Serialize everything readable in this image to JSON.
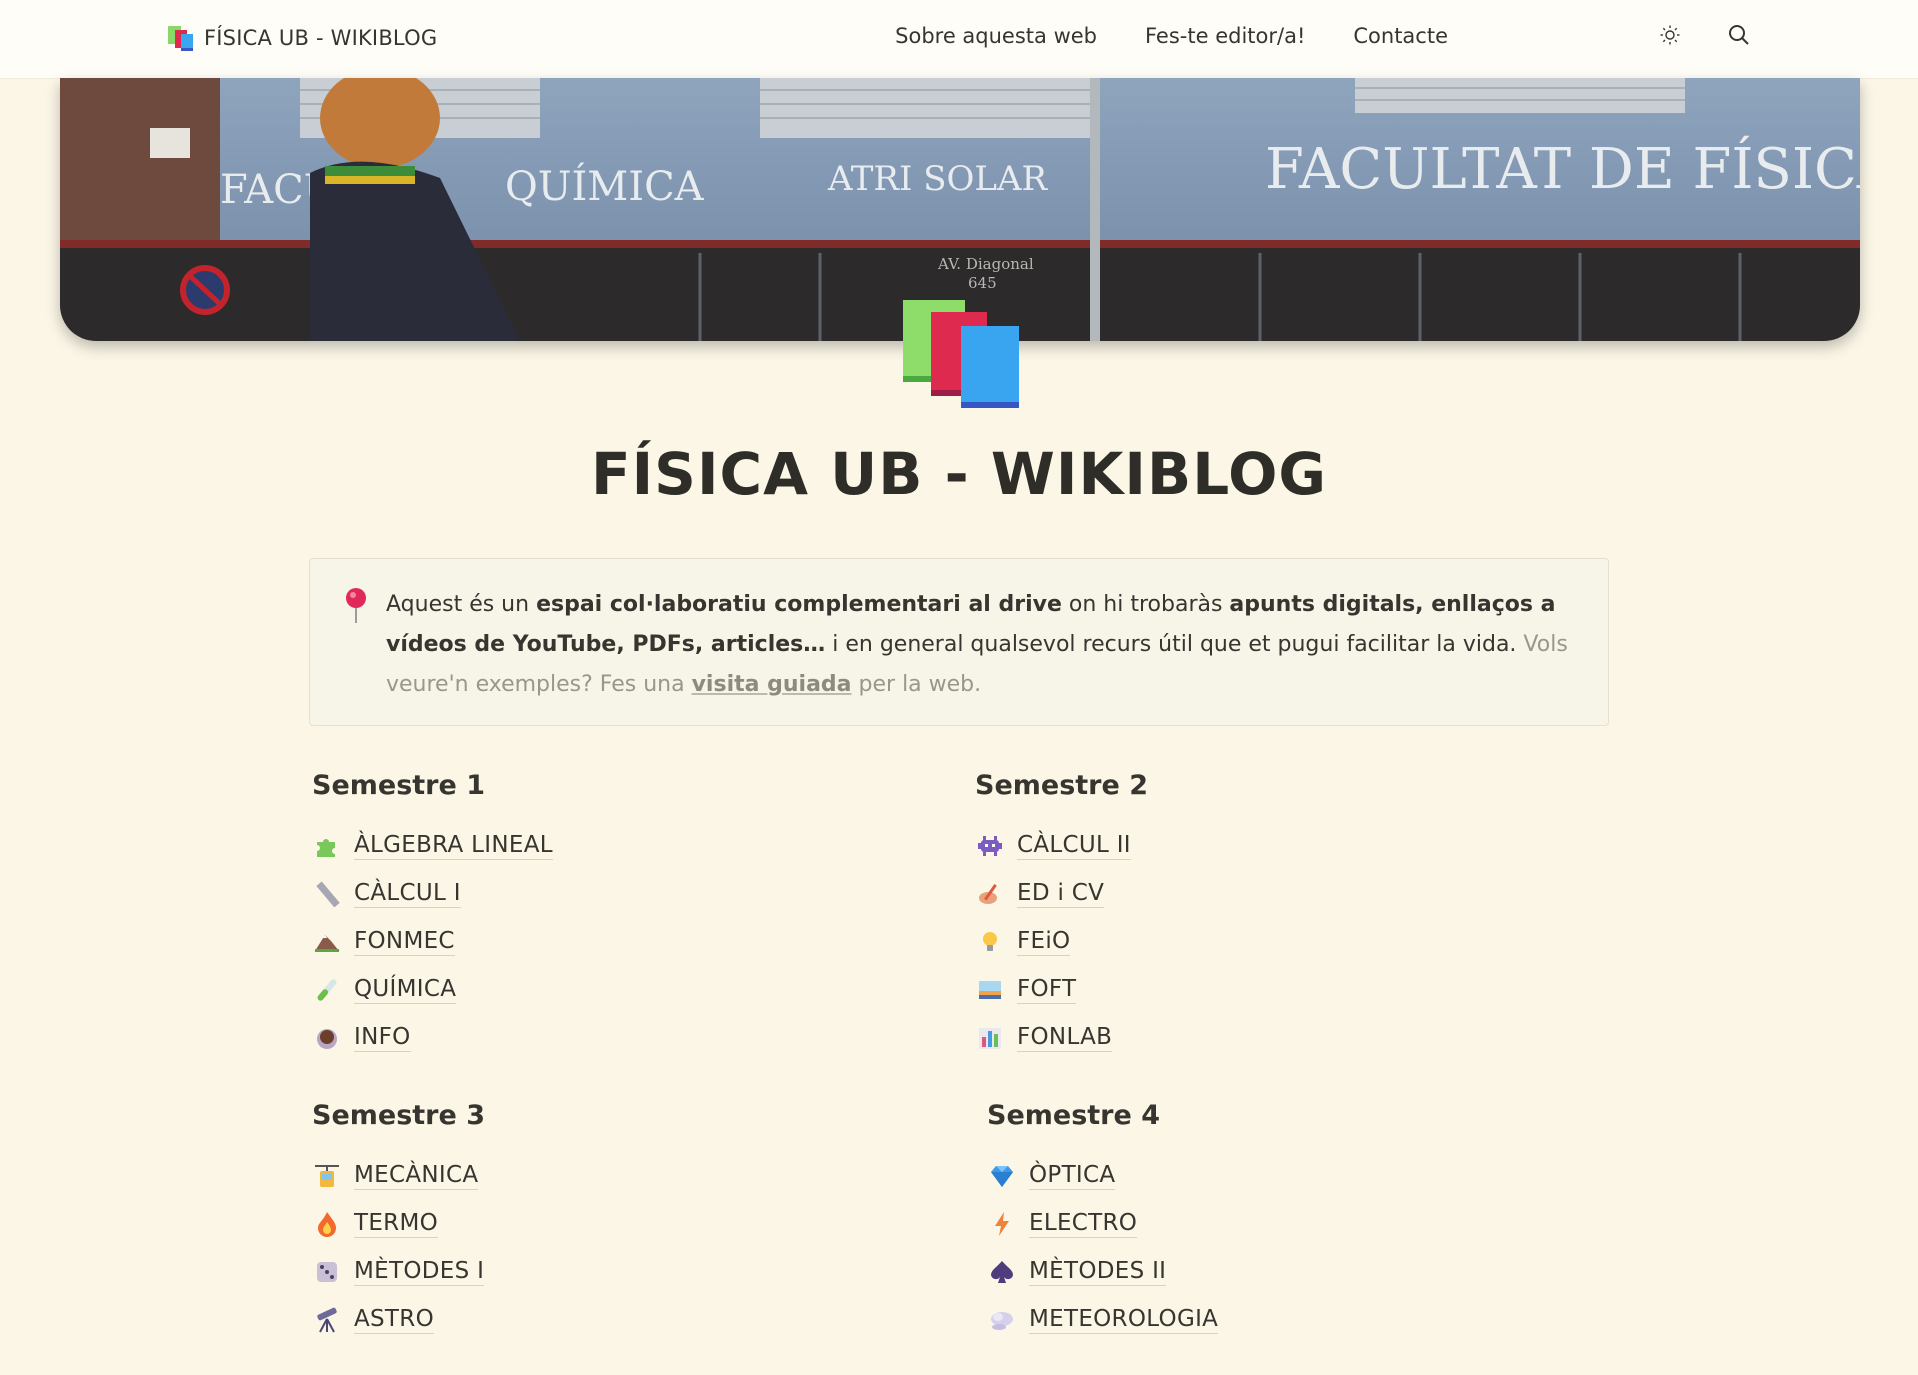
{
  "site": {
    "title": "FÍSICA UB - WIKIBLOG"
  },
  "nav": {
    "links": [
      "Sobre aquesta web",
      "Fes-te editor/a!",
      "Contacte"
    ],
    "theme_icon": "sun-icon",
    "search_icon": "search-icon"
  },
  "banner": {
    "signs": [
      "FACULTAT DE FÍSICA",
      "ATRI SOLAR",
      "FACUL",
      "QUÍMICA",
      "AV. Diagonal",
      "645"
    ]
  },
  "page": {
    "title": "FÍSICA UB - WIKIBLOG"
  },
  "callout": {
    "icon": "pushpin-icon",
    "t1": "Aquest és un ",
    "b1": "espai col·laboratiu complementari al drive",
    "t2": " on hi trobaràs ",
    "b2": "apunts digitals, enllaços a vídeos de YouTube, PDFs, articles…",
    "t3": " i en general qualsevol recurs útil que et pugui facilitar la vida. ",
    "m1": "Vols veure'n exemples? Fes una ",
    "link": "visita guiada",
    "m2": " per la web."
  },
  "semesters": [
    {
      "title": "Semestre 1",
      "items": [
        {
          "label": "ÀLGEBRA LINEAL",
          "icon": "puzzle-icon"
        },
        {
          "label": "CÀLCUL I",
          "icon": "ruler-icon"
        },
        {
          "label": "FONMEC",
          "icon": "mountain-icon"
        },
        {
          "label": "QUÍMICA",
          "icon": "test-tube-icon"
        },
        {
          "label": "INFO",
          "icon": "coffee-icon"
        }
      ]
    },
    {
      "title": "Semestre 2",
      "items": [
        {
          "label": "CÀLCUL II",
          "icon": "alien-monster-icon"
        },
        {
          "label": "ED i CV",
          "icon": "writing-hand-icon"
        },
        {
          "label": "FEiO",
          "icon": "lightbulb-icon"
        },
        {
          "label": "FOFT",
          "icon": "sunrise-picture-icon"
        },
        {
          "label": "FONLAB",
          "icon": "bar-chart-icon"
        }
      ]
    },
    {
      "title": "Semestre 3",
      "items": [
        {
          "label": "MECÀNICA",
          "icon": "aerial-tramway-icon"
        },
        {
          "label": "TERMO",
          "icon": "fire-icon"
        },
        {
          "label": "MÈTODES I",
          "icon": "dice-icon"
        },
        {
          "label": "ASTRO",
          "icon": "telescope-icon"
        }
      ]
    },
    {
      "title": "Semestre 4",
      "items": [
        {
          "label": "ÒPTICA",
          "icon": "gem-icon"
        },
        {
          "label": "ELECTRO",
          "icon": "lightning-icon"
        },
        {
          "label": "MÈTODES II",
          "icon": "spade-icon"
        },
        {
          "label": "METEOROLOGIA",
          "icon": "cloud-icon"
        }
      ]
    }
  ]
}
